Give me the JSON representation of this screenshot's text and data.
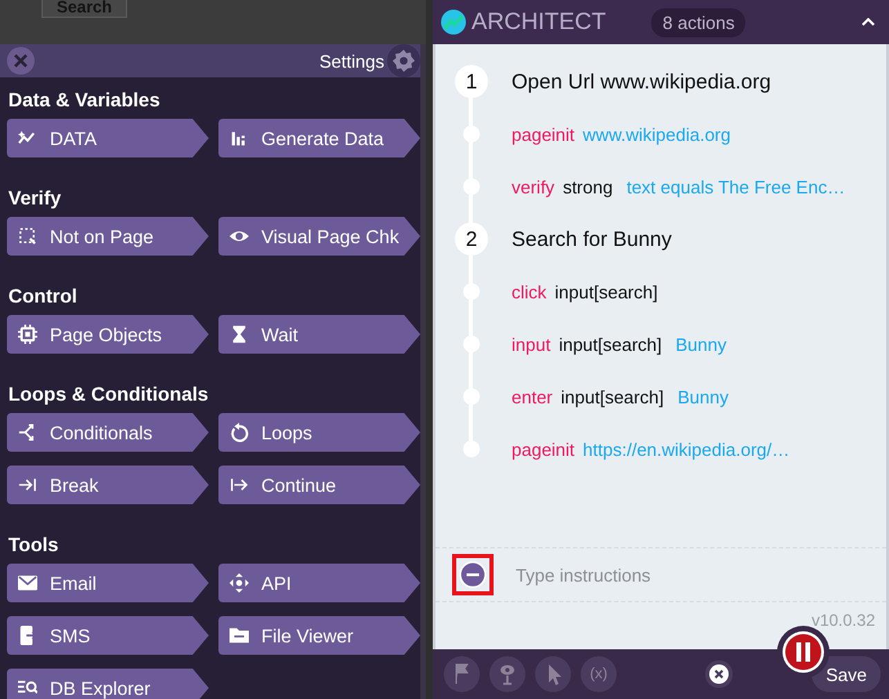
{
  "background_page": {
    "search_button": "Search"
  },
  "toolbox": {
    "title": "Settings",
    "sections": [
      {
        "heading": "Data & Variables",
        "items": [
          "DATA",
          "Generate Data"
        ]
      },
      {
        "heading": "Verify",
        "items": [
          "Not on Page",
          "Visual Page Chk"
        ]
      },
      {
        "heading": "Control",
        "items": [
          "Page Objects",
          "Wait"
        ]
      },
      {
        "heading": "Loops & Conditionals",
        "items": [
          "Conditionals",
          "Loops",
          "Break",
          "Continue"
        ]
      },
      {
        "heading": "Tools",
        "items": [
          "Email",
          "API",
          "SMS",
          "File Viewer",
          "DB Explorer"
        ]
      }
    ]
  },
  "architect": {
    "title": "ARCHITECT",
    "action_count": "8 actions",
    "steps": [
      {
        "number": "1",
        "title": "Open Url www.wikipedia.org",
        "actions": [
          {
            "verb": "pageinit",
            "value": "www.wikipedia.org"
          },
          {
            "verb": "verify",
            "target": "strong",
            "value": "text equals The Free Enc…"
          }
        ]
      },
      {
        "number": "2",
        "title": "Search for Bunny",
        "actions": [
          {
            "verb": "click",
            "target": "input[search]"
          },
          {
            "verb": "input",
            "target": "input[search]",
            "value": "Bunny"
          },
          {
            "verb": "enter",
            "target": "input[search]",
            "value": "Bunny"
          },
          {
            "verb": "pageinit",
            "value": "https://en.wikipedia.org/…"
          }
        ]
      }
    ],
    "composer": {
      "placeholder": "Type instructions",
      "highlighted": true
    },
    "version": "v10.0.32",
    "variable_button": "(x)",
    "save_button": "Save"
  }
}
